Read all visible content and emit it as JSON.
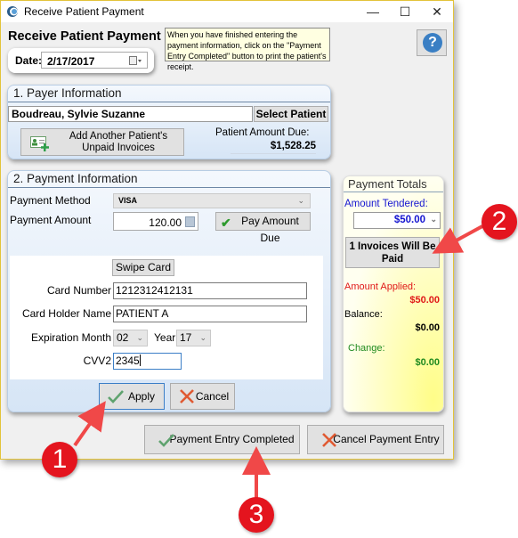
{
  "window": {
    "title": "Receive Patient Payment",
    "controls": {
      "minimize": "—",
      "maximize": "☐",
      "close": "✕"
    }
  },
  "header": {
    "heading": "Receive Patient Payment",
    "date_label": "Date:",
    "date_value": "2/17/2017",
    "note": "When you have finished entering the payment information, click on the \"Payment Entry Completed\" button to print the patient's receipt.",
    "help_glyph": "?"
  },
  "payer": {
    "title": "1. Payer Information",
    "patient_name": "Boudreau, Sylvie Suzanne",
    "select_patient_label": "Select Patient",
    "add_invoices_label": "Add Another Patient's Unpaid Invoices",
    "amount_due_label": "Patient Amount Due:",
    "amount_due_value": "$1,528.25"
  },
  "payment": {
    "title": "2. Payment Information",
    "method_label": "Payment Method",
    "method_value": "VISA",
    "amount_label": "Payment Amount",
    "amount_value": "120.00",
    "pay_amount_due_label": "Pay Amount Due",
    "swipe_card_label": "Swipe Card",
    "card_number_label": "Card Number",
    "card_number_value": "1212312412131",
    "card_holder_label": "Card Holder Name",
    "card_holder_value": "PATIENT A",
    "exp_month_label": "Expiration Month",
    "exp_month_value": "02",
    "year_label": "Year",
    "year_value": "17",
    "cvv_label": "CVV2",
    "cvv_value": "2345",
    "apply_label": "Apply",
    "cancel_label": "Cancel"
  },
  "totals": {
    "title": "Payment Totals",
    "tendered_label": "Amount Tendered:",
    "tendered_value": "$50.00",
    "invoices_button_label": "1 Invoices Will Be Paid",
    "applied_label": "Amount Applied:",
    "applied_value": "$50.00",
    "balance_label": "Balance:",
    "balance_value": "$0.00",
    "change_label": "Change:",
    "change_value": "$0.00",
    "colors": {
      "tendered": "#1515d0",
      "applied": "#e01818",
      "change": "#1f8a1f"
    }
  },
  "footer": {
    "completed_label": "Payment Entry Completed",
    "cancel_entry_label": "Cancel Payment Entry"
  },
  "callouts": [
    {
      "number": "1",
      "target": "Apply"
    },
    {
      "number": "2",
      "target": "1 Invoices Will Be Paid"
    },
    {
      "number": "3",
      "target": "Payment Entry Completed"
    }
  ]
}
